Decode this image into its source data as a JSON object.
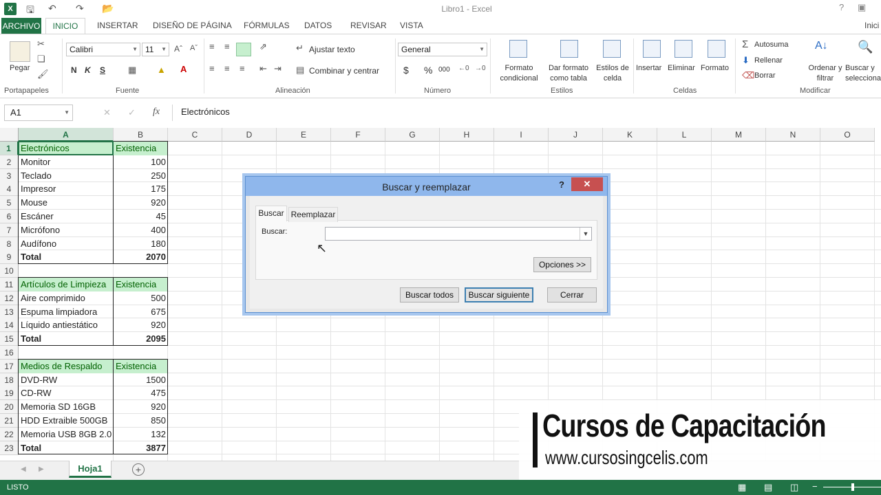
{
  "window": {
    "title": "Libro1 - Excel",
    "help": "?",
    "user": "Inici"
  },
  "tabs": [
    "ARCHIVO",
    "INICIO",
    "INSERTAR",
    "DISEÑO DE PÁGINA",
    "FÓRMULAS",
    "DATOS",
    "REVISAR",
    "VISTA"
  ],
  "ribbon": {
    "clipboard": {
      "paste": "Pegar",
      "group": "Portapapeles"
    },
    "font": {
      "name": "Calibri",
      "size": "11",
      "bold": "N",
      "italic": "K",
      "underline": "S",
      "group": "Fuente"
    },
    "alignment": {
      "wrap": "Ajustar texto",
      "merge": "Combinar y centrar",
      "group": "Alineación"
    },
    "number": {
      "format": "General",
      "currency": "$",
      "percent": "%",
      "thousands": "000",
      "group": "Número"
    },
    "styles": {
      "conditional": [
        "Formato",
        "condicional"
      ],
      "table": [
        "Dar formato",
        "como tabla"
      ],
      "cell": [
        "Estilos de",
        "celda"
      ],
      "group": "Estilos"
    },
    "cells": {
      "insert": "Insertar",
      "delete": "Eliminar",
      "format": "Formato",
      "group": "Celdas"
    },
    "editing": {
      "autosum": "Autosuma",
      "fill": "Rellenar",
      "clear": "Borrar",
      "sort": [
        "Ordenar y",
        "filtrar"
      ],
      "find": [
        "Buscar y",
        "selecciona"
      ],
      "group": "Modificar"
    }
  },
  "formula_bar": {
    "name_box": "A1",
    "fx": "fx",
    "value": "Electrónicos"
  },
  "columns": [
    "A",
    "B",
    "C",
    "D",
    "E",
    "F",
    "G",
    "H",
    "I",
    "J",
    "K",
    "L",
    "M",
    "N",
    "O"
  ],
  "rows": [
    "1",
    "2",
    "3",
    "4",
    "5",
    "6",
    "7",
    "8",
    "9",
    "10",
    "11",
    "12",
    "13",
    "14",
    "15",
    "16",
    "17",
    "18",
    "19",
    "20",
    "21",
    "22",
    "23"
  ],
  "sheet": {
    "tables": [
      {
        "header": "Electrónicos",
        "col": "Existencia",
        "items": [
          [
            "Monitor",
            "100"
          ],
          [
            "Teclado",
            "250"
          ],
          [
            "Impresor",
            "175"
          ],
          [
            "Mouse",
            "920"
          ],
          [
            "Escáner",
            "45"
          ],
          [
            "Micrófono",
            "400"
          ],
          [
            "Audífono",
            "180"
          ]
        ],
        "total_label": "Total",
        "total": "2070"
      },
      {
        "header": "Artículos de Limpieza",
        "col": "Existencia",
        "items": [
          [
            "Aire comprimido",
            "500"
          ],
          [
            "Espuma limpiadora",
            "675"
          ],
          [
            "Líquido antiestático",
            "920"
          ]
        ],
        "total_label": "Total",
        "total": "2095"
      },
      {
        "header": "Medios de Respaldo",
        "col": "Existencia",
        "items": [
          [
            "DVD-RW",
            "1500"
          ],
          [
            "CD-RW",
            "475"
          ],
          [
            "Memoria SD 16GB",
            "920"
          ],
          [
            "HDD Extraible 500GB",
            "850"
          ],
          [
            "Memoria USB 8GB 2.0",
            "132"
          ]
        ],
        "total_label": "Total",
        "total": "3877"
      }
    ]
  },
  "sheet_tabs": {
    "active": "Hoja1",
    "add": "+"
  },
  "status": {
    "mode": "LISTO"
  },
  "dialog": {
    "title": "Buscar y reemplazar",
    "help": "?",
    "close": "✕",
    "tabs": [
      "Buscar",
      "Reemplazar"
    ],
    "find_label": "Buscar:",
    "find_value": "",
    "options": "Opciones >>",
    "find_all": "Buscar todos",
    "find_next": "Buscar siguiente",
    "close_btn": "Cerrar"
  },
  "watermark": {
    "line1": "Cursos de Capacitación",
    "line2": "www.cursosingcelis.com"
  },
  "colors": {
    "excel_green": "#217346",
    "header_fill": "#c6efce",
    "header_text": "#006100",
    "dialog_title": "#8fb7ec",
    "close_red": "#c75050"
  }
}
